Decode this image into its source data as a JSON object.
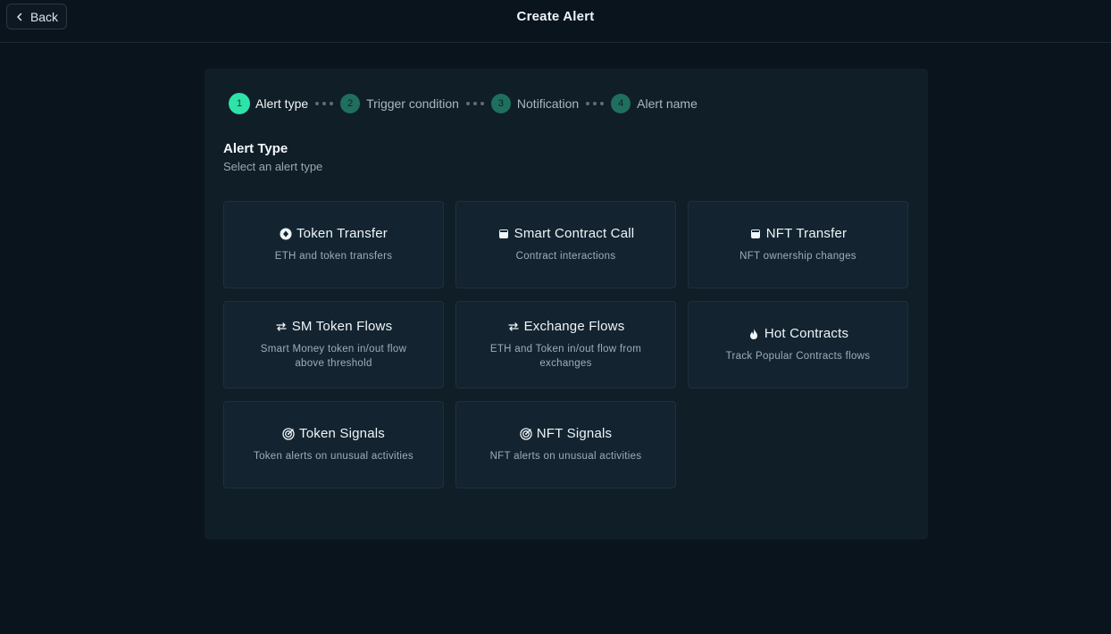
{
  "header": {
    "back_label": "Back",
    "title": "Create Alert"
  },
  "stepper": {
    "steps": [
      {
        "num": "1",
        "label": "Alert type",
        "active": true
      },
      {
        "num": "2",
        "label": "Trigger condition",
        "active": false
      },
      {
        "num": "3",
        "label": "Notification",
        "active": false
      },
      {
        "num": "4",
        "label": "Alert name",
        "active": false
      }
    ]
  },
  "section": {
    "title": "Alert Type",
    "subtitle": "Select an alert type"
  },
  "cards": [
    {
      "icon": "token-icon",
      "title": "Token Transfer",
      "desc": "ETH and token transfers"
    },
    {
      "icon": "contract-icon",
      "title": "Smart Contract Call",
      "desc": "Contract interactions"
    },
    {
      "icon": "nft-icon",
      "title": "NFT Transfer",
      "desc": "NFT ownership changes"
    },
    {
      "icon": "arrows-swap-icon",
      "title": "SM Token Flows",
      "desc": "Smart Money token in/out flow above threshold"
    },
    {
      "icon": "arrows-swap-icon",
      "title": "Exchange Flows",
      "desc": "ETH and Token in/out flow from exchanges"
    },
    {
      "icon": "flame-icon",
      "title": "Hot Contracts",
      "desc": "Track Popular Contracts flows"
    },
    {
      "icon": "radar-icon",
      "title": "Token Signals",
      "desc": "Token alerts on unusual activities"
    },
    {
      "icon": "radar-icon",
      "title": "NFT Signals",
      "desc": "NFT alerts on unusual activities"
    }
  ],
  "colors": {
    "background": "#0a141d",
    "panel": "#101e28",
    "card": "#132430",
    "accent": "#2de3a8",
    "step_inactive": "#1f6f5e"
  }
}
